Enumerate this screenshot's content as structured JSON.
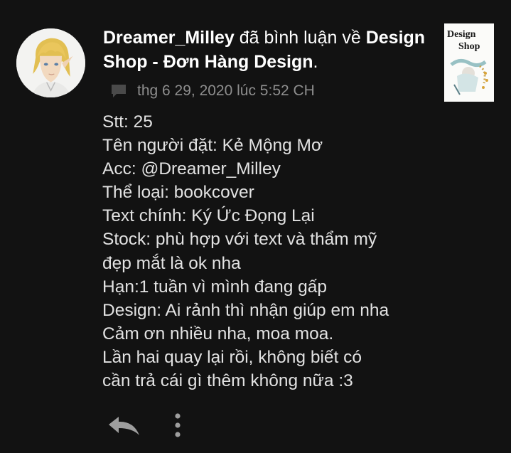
{
  "notification": {
    "user_name": "Dreamer_Milley",
    "action_text": " đã bình luận về ",
    "story_title": "Design Shop - Đơn Hàng Design",
    "title_end": ".",
    "timestamp": "thg 6 29, 2020 lúc 5:52 CH",
    "thumbnail": {
      "line1": "Design",
      "line2": "Shop"
    }
  },
  "comment": {
    "lines": [
      "Stt: 25",
      "Tên người đặt: Kẻ Mộng Mơ",
      "Acc: @Dreamer_Milley",
      "Thể loại: bookcover",
      "Text chính: Ký Ức Đọng Lại",
      "Stock: phù hợp với text và thẩm mỹ",
      "đẹp mắt là ok nha",
      "Hạn:1 tuần vì mình đang gấp",
      "Design: Ai rảnh thì nhận giúp em nha",
      "Cảm ơn nhiều nha, moa moa.",
      "Lần hai quay lại rồi, không biết có",
      "cần trả cái gì thêm không nữa :3"
    ]
  },
  "icons": {
    "comment": "speech-bubble-icon",
    "reply": "reply-arrow-icon",
    "more": "vertical-dots-icon"
  },
  "colors": {
    "background": "#121212",
    "text_primary": "#ffffff",
    "text_body": "#e2e2e2",
    "text_meta": "#8e8e8e",
    "icon_muted": "#4a4a4a",
    "icon_action": "#9e9e9e"
  }
}
